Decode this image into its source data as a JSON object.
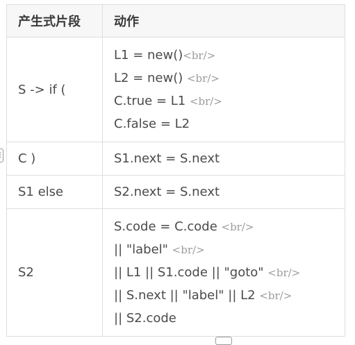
{
  "table": {
    "headers": [
      "产生式片段",
      "动作"
    ],
    "rows": [
      {
        "production": "S -> if (",
        "actions": [
          {
            "text": "L1 = new()",
            "sep": "<br/>"
          },
          {
            "text": "L2 = new() ",
            "sep": "<br/>"
          },
          {
            "text": "C.true = L1 ",
            "sep": "<br/>"
          },
          {
            "text": "C.false = L2",
            "sep": ""
          }
        ]
      },
      {
        "production": "C )",
        "actions": [
          {
            "text": "S1.next = S.next",
            "sep": ""
          }
        ]
      },
      {
        "production": "S1 else",
        "actions": [
          {
            "text": "S2.next = S.next",
            "sep": ""
          }
        ]
      },
      {
        "production": "S2",
        "actions": [
          {
            "text": "S.code = C.code ",
            "sep": "<br/>"
          },
          {
            "text": "|| \"label\" ",
            "sep": "<br/>"
          },
          {
            "text": "|| L1 || S1.code || \"goto\" ",
            "sep": "<br/>"
          },
          {
            "text": "|| S.next || \"label\" || L2  ",
            "sep": "<br/>"
          },
          {
            "text": "|| S2.code",
            "sep": ""
          }
        ]
      }
    ]
  }
}
